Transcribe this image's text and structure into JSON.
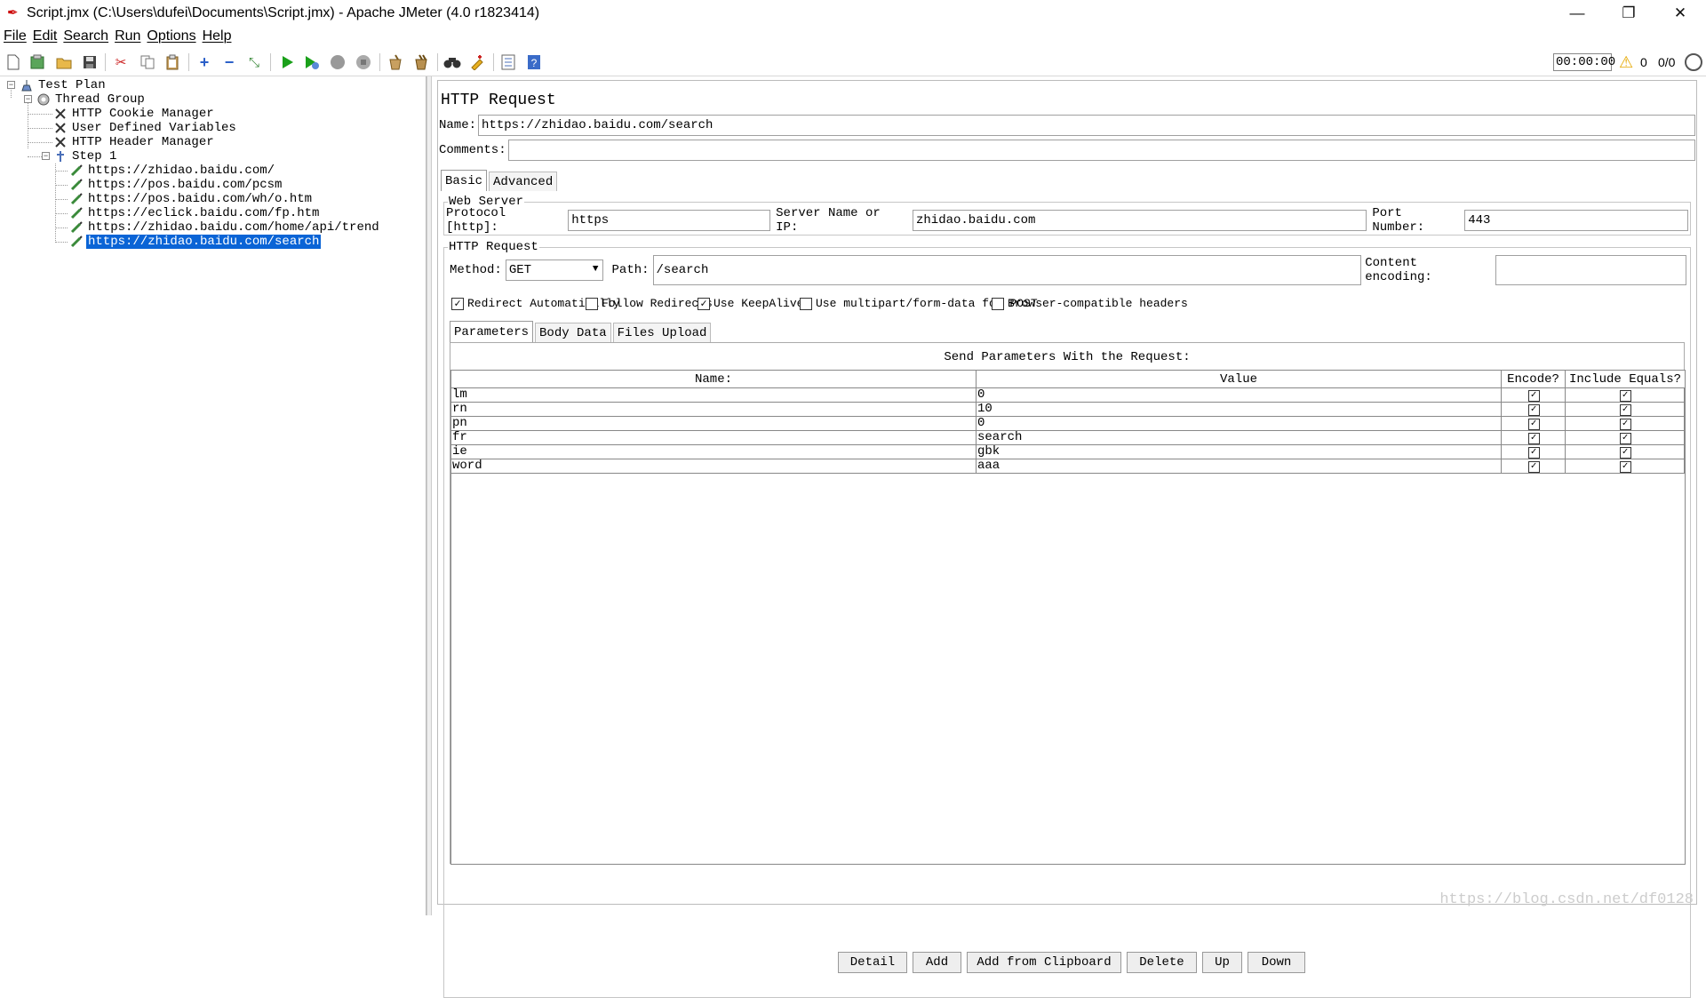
{
  "window": {
    "title": "Script.jmx (C:\\Users\\dufei\\Documents\\Script.jmx) - Apache JMeter (4.0 r1823414)",
    "minimize_glyph": "—",
    "maximize_glyph": "❐",
    "close_glyph": "✕"
  },
  "menu": [
    "File",
    "Edit",
    "Search",
    "Run",
    "Options",
    "Help"
  ],
  "toolbar": {
    "icons": [
      "new-icon",
      "templates-icon",
      "open-icon",
      "save-icon",
      "cut-icon",
      "copy-icon",
      "paste-icon",
      "expand-icon",
      "collapse-icon",
      "toggle-icon",
      "start-icon",
      "start-no-pauses-icon",
      "stop-icon",
      "shutdown-icon",
      "clear-icon",
      "clear-all-icon",
      "search-icon",
      "reset-search-icon",
      "function-helper-icon",
      "help-icon"
    ],
    "timer": "00:00:00",
    "error_count": "0",
    "thread_count": "0/0"
  },
  "tree": {
    "test_plan": "Test Plan",
    "thread_group": "Thread Group",
    "cookie_manager": "HTTP Cookie Manager",
    "user_vars": "User Defined Variables",
    "header_manager": "HTTP Header Manager",
    "step": "Step 1",
    "samplers": [
      "https://zhidao.baidu.com/",
      "https://pos.baidu.com/pcsm",
      "https://pos.baidu.com/wh/o.htm",
      "https://eclick.baidu.com/fp.htm",
      "https://zhidao.baidu.com/home/api/trend",
      "https://zhidao.baidu.com/search"
    ]
  },
  "panel": {
    "title": "HTTP Request",
    "name_label": "Name:",
    "name_value": "https://zhidao.baidu.com/search",
    "comments_label": "Comments:",
    "comments_value": "",
    "tabs": [
      "Basic",
      "Advanced"
    ],
    "web_server": {
      "title": "Web Server",
      "protocol_label": "Protocol [http]:",
      "protocol_value": "https",
      "server_label": "Server Name or IP:",
      "server_value": "zhidao.baidu.com",
      "port_label": "Port Number:",
      "port_value": "443"
    },
    "http_request": {
      "title": "HTTP Request",
      "method_label": "Method:",
      "method_value": "GET",
      "path_label": "Path:",
      "path_value": "/search",
      "encoding_label": "Content encoding:",
      "encoding_value": ""
    },
    "checkboxes": {
      "redirect_auto": {
        "label": "Redirect Automatically",
        "checked": "✓"
      },
      "follow_redirects": {
        "label": "Follow Redirects",
        "checked": ""
      },
      "keepalive": {
        "label": "Use KeepAlive",
        "checked": "✓"
      },
      "multipart": {
        "label": "Use multipart/form-data for POST",
        "checked": ""
      },
      "browser_headers": {
        "label": "Browser-compatible headers",
        "checked": ""
      }
    },
    "subtabs": [
      "Parameters",
      "Body Data",
      "Files Upload"
    ],
    "params_caption": "Send Parameters With the Request:",
    "params_headers": [
      "Name:",
      "Value",
      "Encode?",
      "Include Equals?"
    ],
    "params": [
      {
        "name": "lm",
        "value": "0",
        "encode": "✓",
        "equals": "✓"
      },
      {
        "name": "rn",
        "value": "10",
        "encode": "✓",
        "equals": "✓"
      },
      {
        "name": "pn",
        "value": "0",
        "encode": "✓",
        "equals": "✓"
      },
      {
        "name": "fr",
        "value": "search",
        "encode": "✓",
        "equals": "✓"
      },
      {
        "name": "ie",
        "value": "gbk",
        "encode": "✓",
        "equals": "✓"
      },
      {
        "name": "word",
        "value": "aaa",
        "encode": "✓",
        "equals": "✓"
      }
    ],
    "buttons": [
      "Detail",
      "Add",
      "Add from Clipboard",
      "Delete",
      "Up",
      "Down"
    ]
  },
  "watermark": "https://blog.csdn.net/df0128",
  "colors": {
    "selection": "#0a64d6",
    "start": "#1aa01a",
    "warning": "#e5a800"
  }
}
